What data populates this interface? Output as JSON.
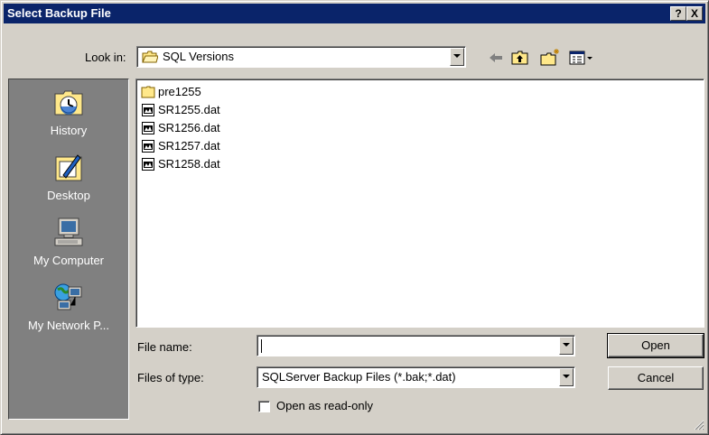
{
  "window": {
    "title": "Select Backup File"
  },
  "titlebar_buttons": {
    "help": "?",
    "close": "X"
  },
  "lookin": {
    "label": "Look in:",
    "value": "SQL Versions"
  },
  "places": [
    {
      "label": "History"
    },
    {
      "label": "Desktop"
    },
    {
      "label": "My Computer"
    },
    {
      "label": "My Network P..."
    }
  ],
  "files": [
    {
      "name": "pre1255",
      "icon": "folder-icon"
    },
    {
      "name": "SR1255.dat",
      "icon": "file-icon"
    },
    {
      "name": "SR1256.dat",
      "icon": "file-icon"
    },
    {
      "name": "SR1257.dat",
      "icon": "file-icon"
    },
    {
      "name": "SR1258.dat",
      "icon": "file-icon"
    }
  ],
  "filename": {
    "label": "File name:",
    "value": ""
  },
  "filetype": {
    "label": "Files of type:",
    "value": "SQLServer Backup Files (*.bak;*.dat)"
  },
  "readonly": {
    "label": "Open as read-only",
    "checked": false
  },
  "buttons": {
    "open": "Open",
    "cancel": "Cancel"
  },
  "colors": {
    "titlebar": "#0a246a",
    "face": "#d4d0c8",
    "places_bg": "#808080"
  }
}
